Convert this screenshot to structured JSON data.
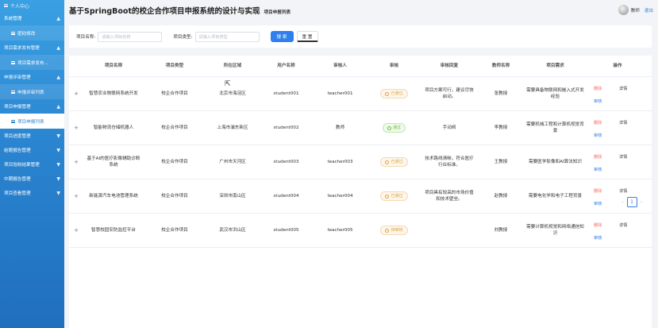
{
  "sidebar": {
    "top_label": "个人中心",
    "items": [
      {
        "label": "系统管理",
        "chev": "▲"
      },
      {
        "label": "密码修改",
        "sub": true
      },
      {
        "label": "项目需求发布管理",
        "chev": "▲"
      },
      {
        "label": "项目需求发布...",
        "sub": true
      },
      {
        "label": "申报评审管理",
        "chev": "▲"
      },
      {
        "label": "申报评审列表",
        "sub": true
      },
      {
        "label": "项目申报管理",
        "chev": "▲"
      },
      {
        "label": "项目申报列表",
        "sub": true,
        "active": true
      },
      {
        "label": "项目进度管理",
        "chev": "▼"
      },
      {
        "label": "结题报告管理",
        "chev": "▼"
      },
      {
        "label": "项目验收结果管理",
        "chev": "▼"
      },
      {
        "label": "中期报告管理",
        "chev": "▼"
      },
      {
        "label": "项目查看管理",
        "chev": "▼"
      }
    ]
  },
  "header": {
    "title": "基于SpringBoot的校企合作项目申报系统的设计与实现",
    "breadcrumb": "项目申报列表",
    "username": "教师",
    "logout": "退出"
  },
  "search": {
    "name_label": "项目名称:",
    "name_placeholder": "请输入项目名称",
    "type_label": "项目类型:",
    "type_placeholder": "请输入项目类型",
    "search_btn": "搜 索",
    "reset_btn": "重 置"
  },
  "table": {
    "headers": [
      "项目名称",
      "项目类型",
      "所在区域",
      "用户名称",
      "审核人",
      "审核",
      "审核回复",
      "教师名称",
      "项目需求",
      "操作"
    ],
    "rows": [
      {
        "name": "智慧农业物联网系统开发",
        "type": "校企合作项目",
        "area": "北京市海淀区",
        "user": "student001",
        "auditor": "teacher001",
        "status": "已通过",
        "status_kind": "pending",
        "reply": "项目方案可行，建议尽快启动。",
        "teacher": "张教授",
        "req": "需要具备物联网和嵌入式开发经验"
      },
      {
        "name": "智能物流仓储机器人",
        "type": "校企合作项目",
        "area": "上海市浦东新区",
        "user": "student002",
        "auditor": "教师",
        "status": "通过",
        "status_kind": "pass",
        "reply": "手动阀",
        "teacher": "李教授",
        "req": "需要机械工程和计算机视觉背景"
      },
      {
        "name": "基于AI的医疗影像辅助诊断系统",
        "type": "校企合作项目",
        "area": "广州市天河区",
        "user": "student003",
        "auditor": "teacher003",
        "status": "已通过",
        "status_kind": "pending",
        "reply": "技术路线清晰，符合医疗行业标准。",
        "teacher": "王教授",
        "req": "需要医学影像和AI算法知识"
      },
      {
        "name": "新能源汽车电池管理系统",
        "type": "校企合作项目",
        "area": "深圳市南山区",
        "user": "student004",
        "auditor": "teacher004",
        "status": "已通过",
        "status_kind": "pending",
        "reply": "项目具有较高的市场价值和技术壁垒。",
        "teacher": "赵教授",
        "req": "需要电化学和电子工程背景"
      },
      {
        "name": "智慧校园安防监控平台",
        "type": "校企合作项目",
        "area": "武汉市洪山区",
        "user": "student005",
        "auditor": "teacher005",
        "status": "待审核",
        "status_kind": "pending",
        "reply": "",
        "teacher": "刘教授",
        "req": "需要计算机视觉和网络通信知识"
      }
    ],
    "ops": {
      "delete": "删除",
      "detail": "详情",
      "audit": "审核"
    },
    "expand_icon": "+"
  },
  "pager": {
    "prev": "‹",
    "page": "1",
    "next": "›"
  }
}
